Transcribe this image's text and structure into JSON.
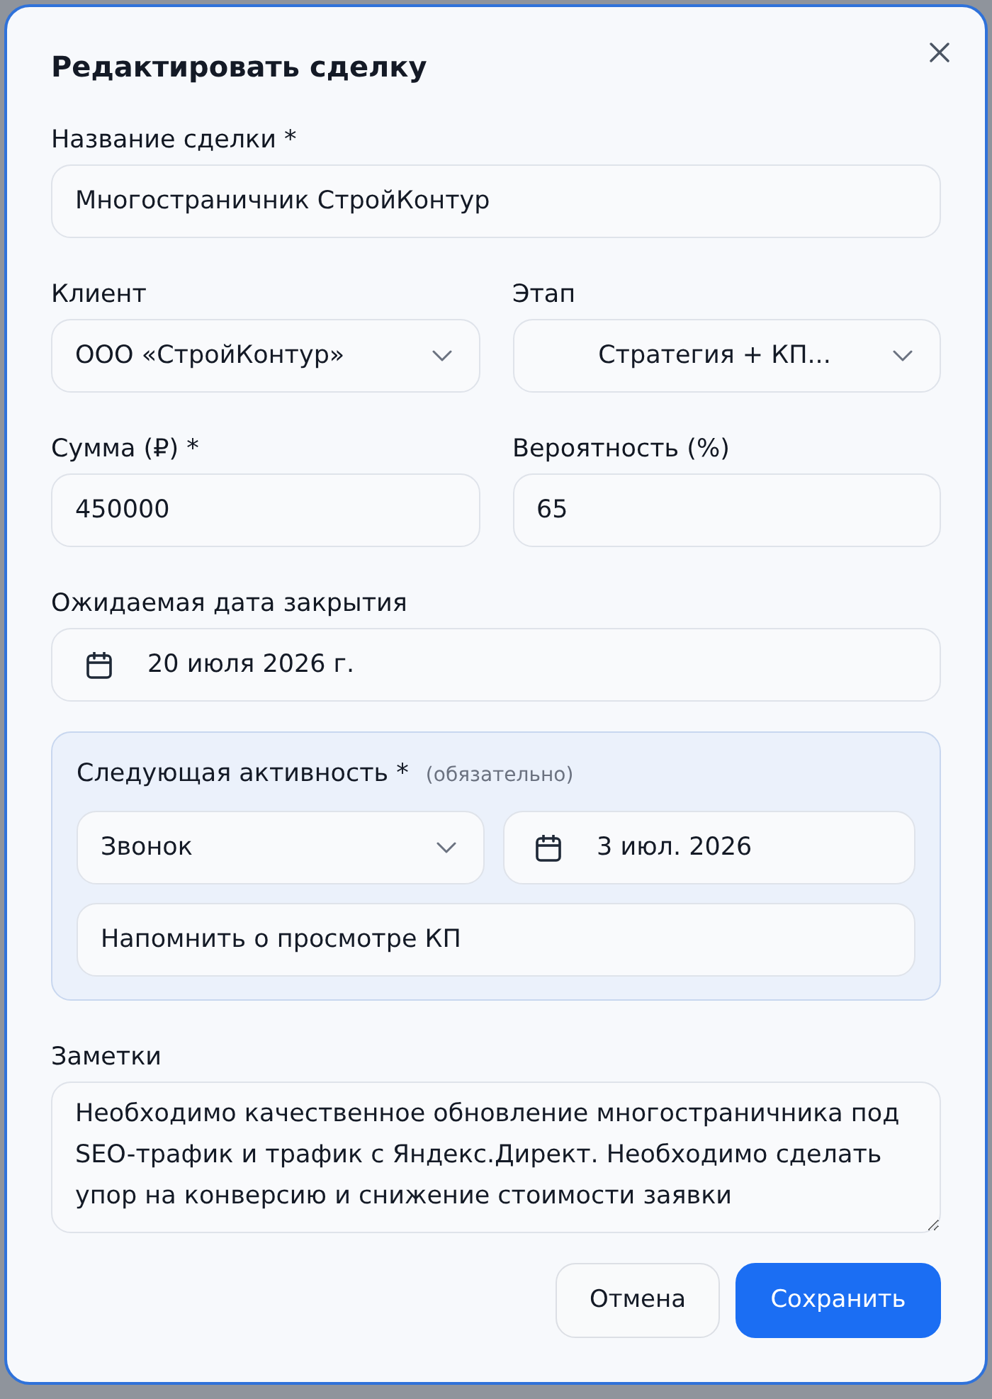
{
  "dialog": {
    "title": "Редактировать сделку"
  },
  "rows": [
    [
      {
        "kind": "text",
        "label": "Название сделки *",
        "value": "Многостраничник СтройКонтур"
      }
    ],
    [
      {
        "kind": "select",
        "label": "Клиент",
        "value": "ООО «СтройКонтур»"
      },
      {
        "kind": "select",
        "label": "Этап",
        "value": "Стратегия + КП..."
      }
    ],
    [
      {
        "kind": "text",
        "label": "Сумма (₽) *",
        "value": "450000"
      },
      {
        "kind": "text",
        "label": "Вероятность (%)",
        "value": "65"
      }
    ],
    [
      {
        "kind": "date",
        "label": "Ожидаемая дата закрытия",
        "value": "20 июля 2026 г."
      }
    ]
  ],
  "next_activity": {
    "label": "Следующая активность *",
    "hint": "(обязательно)",
    "fields": [
      {
        "kind": "select",
        "value": "Звонок"
      },
      {
        "kind": "date",
        "value": "3 июл. 2026"
      },
      {
        "kind": "text",
        "value": "Напомнить о просмотре КП"
      }
    ]
  },
  "notes": {
    "label": "Заметки",
    "value": "Необходимо качественное обновление многостраничника под SEO-трафик и трафик с Яндекс.Директ. Необходимо сделать упор на конверсию и снижение стоимости заявки"
  },
  "buttons": [
    {
      "label": "Отмена",
      "kind": "secondary"
    },
    {
      "label": "Сохранить",
      "kind": "primary"
    }
  ]
}
